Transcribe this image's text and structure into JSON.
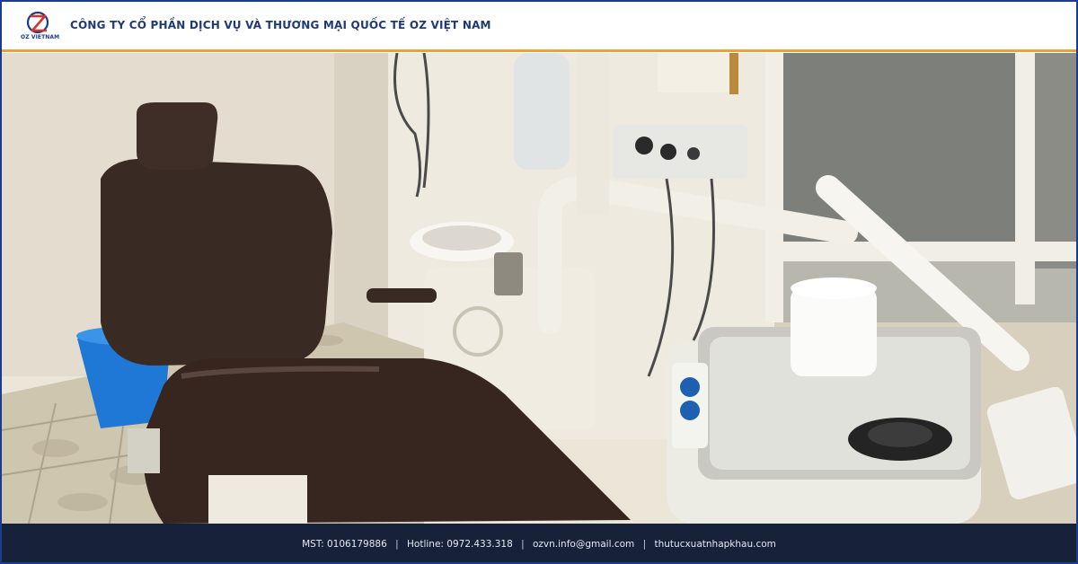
{
  "header": {
    "logo_text": "OZ VIETNAM",
    "company_name": "CÔNG TY CỔ PHẦN DỊCH VỤ VÀ THƯƠNG MẠI QUỐC TẾ OZ VIỆT NAM"
  },
  "photo": {
    "subject": "dental-chair-photo"
  },
  "footer": {
    "mst": "MST: 0106179886",
    "hotline": "Hotline: 0972.433.318",
    "email": "ozvn.info@gmail.com",
    "website": "thutucxuatnhapkhau.com",
    "separator": "|"
  },
  "colors": {
    "brand_blue": "#1f3a78",
    "accent_orange": "#e8a33d",
    "footer_bg": "#17213a"
  }
}
